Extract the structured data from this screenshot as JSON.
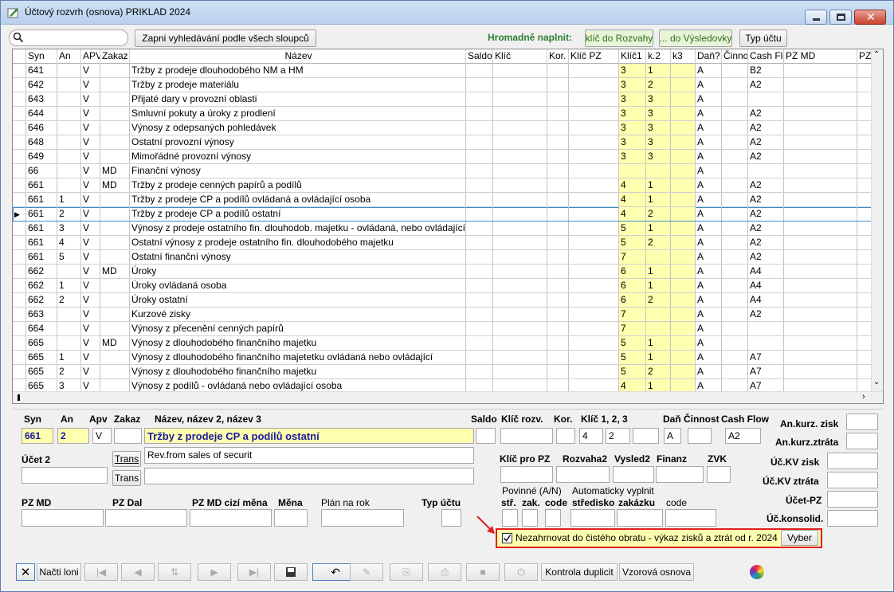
{
  "window": {
    "title": "Účtový rozvrh (osnova) PRIKLAD 2024"
  },
  "toolbar": {
    "search_all_label": "Zapni vyhledávání podle všech sloupců",
    "bulk_fill_label": "Hromadně naplnit:",
    "fill_rozvaha_label": "klíč do Rozvahy",
    "fill_vysledovka_label": "... do Výsledovky",
    "account_type_label": "Typ účtu"
  },
  "grid": {
    "columns": [
      "Syn",
      "An",
      "APV",
      "Zakaz",
      "Název",
      "Saldo",
      "Klíč",
      "Kor.",
      "Klíč PZ",
      "Klíč1",
      "k.2",
      "k3",
      "Daň?",
      "Činno",
      "Cash Flo",
      "PZ MD",
      "PZ"
    ],
    "rows": [
      [
        "641",
        "",
        "V",
        "",
        "Tržby z prodeje dlouhodobého  NM a HM",
        "",
        "",
        "",
        "",
        "3",
        "1",
        "",
        "A",
        "",
        "B2"
      ],
      [
        "642",
        "",
        "V",
        "",
        "Tržby z prodeje materiálu",
        "",
        "",
        "",
        "",
        "3",
        "2",
        "",
        "A",
        "",
        "A2"
      ],
      [
        "643",
        "",
        "V",
        "",
        "Přijaté dary v provozní oblasti",
        "",
        "",
        "",
        "",
        "3",
        "3",
        "",
        "A",
        "",
        ""
      ],
      [
        "644",
        "",
        "V",
        "",
        "Smluvní pokuty a úroky z prodlení",
        "",
        "",
        "",
        "",
        "3",
        "3",
        "",
        "A",
        "",
        "A2"
      ],
      [
        "646",
        "",
        "V",
        "",
        "Výnosy z odepsaných pohledávek",
        "",
        "",
        "",
        "",
        "3",
        "3",
        "",
        "A",
        "",
        "A2"
      ],
      [
        "648",
        "",
        "V",
        "",
        "Ostatní provozní výnosy",
        "",
        "",
        "",
        "",
        "3",
        "3",
        "",
        "A",
        "",
        "A2"
      ],
      [
        "649",
        "",
        "V",
        "",
        "Mimořádné provozní výnosy",
        "",
        "",
        "",
        "",
        "3",
        "3",
        "",
        "A",
        "",
        "A2"
      ],
      [
        "66",
        "",
        "V",
        "MD",
        "Finanční výnosy",
        "",
        "",
        "",
        "",
        "",
        "",
        "",
        "A",
        "",
        ""
      ],
      [
        "661",
        "",
        "V",
        "MD",
        "Tržby z prodeje cenných papírů a podílů",
        "",
        "",
        "",
        "",
        "4",
        "1",
        "",
        "A",
        "",
        "A2"
      ],
      [
        "661",
        "1",
        "V",
        "",
        "Tržby z prodeje CP a podílů ovládaná a ovládající osoba",
        "",
        "",
        "",
        "",
        "4",
        "1",
        "",
        "A",
        "",
        "A2"
      ],
      [
        "661",
        "2",
        "V",
        "",
        "Tržby z prodeje CP a podílů ostatní",
        "",
        "",
        "",
        "",
        "4",
        "2",
        "",
        "A",
        "",
        "A2"
      ],
      [
        "661",
        "3",
        "V",
        "",
        "Výnosy z prodeje ostatního fin. dlouhodob. majetku - ovládaná, nebo ovládající",
        "",
        "",
        "",
        "",
        "5",
        "1",
        "",
        "A",
        "",
        "A2"
      ],
      [
        "661",
        "4",
        "V",
        "",
        "Ostatní výnosy z prodeje ostatního fin. dlouhodobého majetku",
        "",
        "",
        "",
        "",
        "5",
        "2",
        "",
        "A",
        "",
        "A2"
      ],
      [
        "661",
        "5",
        "V",
        "",
        "Ostatní finanční výnosy",
        "",
        "",
        "",
        "",
        "7",
        "",
        "",
        "A",
        "",
        "A2"
      ],
      [
        "662",
        "",
        "V",
        "MD",
        "Úroky",
        "",
        "",
        "",
        "",
        "6",
        "1",
        "",
        "A",
        "",
        "A4"
      ],
      [
        "662",
        "1",
        "V",
        "",
        "Úroky ovládaná osoba",
        "",
        "",
        "",
        "",
        "6",
        "1",
        "",
        "A",
        "",
        "A4"
      ],
      [
        "662",
        "2",
        "V",
        "",
        "Úroky ostatní",
        "",
        "",
        "",
        "",
        "6",
        "2",
        "",
        "A",
        "",
        "A4"
      ],
      [
        "663",
        "",
        "V",
        "",
        "Kurzové zisky",
        "",
        "",
        "",
        "",
        "7",
        "",
        "",
        "A",
        "",
        "A2"
      ],
      [
        "664",
        "",
        "V",
        "",
        "Výnosy z přecenění cenných papírů",
        "",
        "",
        "",
        "",
        "7",
        "",
        "",
        "A",
        "",
        ""
      ],
      [
        "665",
        "",
        "V",
        "MD",
        "Výnosy z dlouhodobého finančního majetku",
        "",
        "",
        "",
        "",
        "5",
        "1",
        "",
        "A",
        "",
        ""
      ],
      [
        "665",
        "1",
        "V",
        "",
        "Výnosy z dlouhodobého finančního majetetku ovládaná nebo ovládající",
        "",
        "",
        "",
        "",
        "5",
        "1",
        "",
        "A",
        "",
        "A7"
      ],
      [
        "665",
        "2",
        "V",
        "",
        "Výnosy z dlouhodobého finančního majetku",
        "",
        "",
        "",
        "",
        "5",
        "2",
        "",
        "A",
        "",
        "A7"
      ],
      [
        "665",
        "3",
        "V",
        "",
        "Výnosy z podílů - ovládaná nebo ovládající osoba",
        "",
        "",
        "",
        "",
        "4",
        "1",
        "",
        "A",
        "",
        "A7"
      ]
    ]
  },
  "detail": {
    "labels": {
      "syn": "Syn",
      "an": "An",
      "apv": "Apv",
      "zakaz": "Zakaz",
      "nazev": "Název, název 2, název 3",
      "saldo": "Saldo",
      "klic_rozv": "Klíč rozv.",
      "kor": "Kor.",
      "klic123": "Klíč  1,  2,  3",
      "dan": "Daň",
      "cinnost": "Činnost",
      "cash_flow": "Cash Flow",
      "an_kurz_zisk": "An.kurz. zisk",
      "an_kurz_ztrata": "An.kurz.ztráta",
      "ucet2": "Účet 2",
      "trans": "Trans",
      "klic_pz": "Klíč pro PZ",
      "rozvaha2": "Rozvaha2",
      "vysled2": "Vysled2",
      "finanz": "Finanz",
      "zvk": "ZVK",
      "uc_kv_zisk": "Úč.KV zisk",
      "uc_kv_ztrata": "Úč.KV ztráta",
      "ucet_pz": "Účet-PZ",
      "uc_konsolid": "Úč.konsolid.",
      "povinne": "Povinné (A/N)",
      "auto_vyplnit": "Automaticky vyplnit",
      "str": "stř.",
      "zak": "zak.",
      "code": "code",
      "stredisko": "středisko",
      "zakazku": "zakázku",
      "pz_md": "PZ MD",
      "pz_dal": "PZ Dal",
      "pz_md_cizi": "PZ MD cizí měna",
      "mena": "Měna",
      "plan": "Plán na rok",
      "typ_uctu": "Typ účtu"
    },
    "values": {
      "syn": "661",
      "an": "2",
      "apv": "V",
      "nazev": "Tržby z prodeje CP a podílů ostatní",
      "klic1": "4",
      "klic2": "2",
      "dan": "A",
      "cash_flow": "A2",
      "nazev2": "Rev.from sales of securit"
    },
    "checkbox_label": "Nezahrnovat do čistého obratu - výkaz zisků a ztrát od r. 2024",
    "vyber_label": "Vyber"
  },
  "bottom": {
    "load_label": "Načti loni",
    "dup_label": "Kontrola duplicit",
    "template_label": "Vzorová osnova"
  },
  "colors": {
    "highlight": "#ffffb0",
    "selection": "#3c8bd0",
    "accent_green": "#2e7d32",
    "red_frame": "#e02020"
  }
}
